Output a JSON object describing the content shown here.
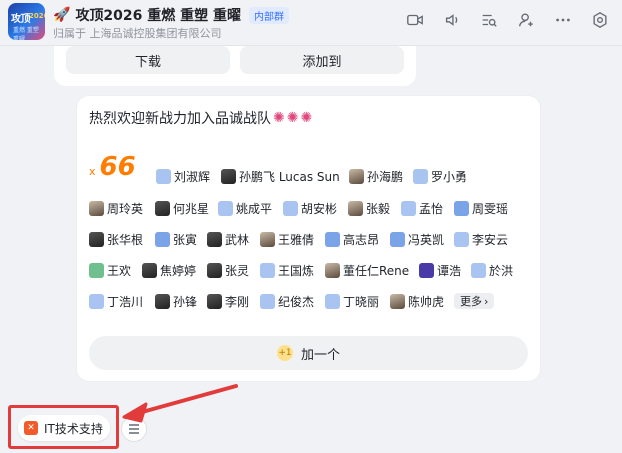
{
  "header": {
    "avatar_text": [
      "攻顶",
      "2026",
      "重燃 重塑 重曜"
    ],
    "title": "攻顶2026 重燃 重塑 重曜",
    "badge": "内部群",
    "subtitle": "归属于 上海品诚控股集团有限公司"
  },
  "top_card": {
    "download_label": "下载",
    "add_to_label": "添加到"
  },
  "card": {
    "title": "热烈欢迎新战力加入品诚战队",
    "count_prefix": "x",
    "count": "66",
    "people": [
      "刘淑辉",
      "孙鹏飞 Lucas Sun",
      "孙海鹏",
      "罗小勇",
      "周玲英",
      "何兆星",
      "姚成平",
      "胡安彬",
      "张毅",
      "孟怡",
      "周雯瑶",
      "张华根",
      "张寅",
      "武林",
      "王雅倩",
      "高志昂",
      "冯英凯",
      "李安云",
      "王欢",
      "焦婷婷",
      "张灵",
      "王国炼",
      "董任仁Rene",
      "谭浩",
      "於洪",
      "丁浩川",
      "孙锋",
      "李刚",
      "纪俊杰",
      "丁晓丽",
      "陈帅虎"
    ],
    "more_label": "更多",
    "add_button_label": "加一个"
  },
  "shortcut": {
    "label": "IT技术支持"
  },
  "colors": {
    "accent": "#3370ff",
    "count": "#ff7d00",
    "highlight_box": "#e23b3b"
  }
}
